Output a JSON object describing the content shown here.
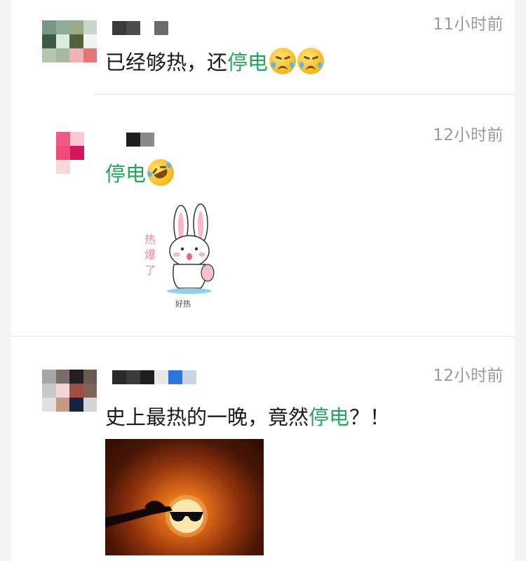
{
  "posts": [
    {
      "time": "11小时前",
      "text_before": "已经够热，还",
      "highlight": "停电",
      "text_after": "",
      "emojis": [
        "persevering-face",
        "persevering-face"
      ]
    },
    {
      "time": "12小时前",
      "text_before": "",
      "highlight": "停电",
      "text_after": "",
      "emojis": [
        "rolling-laughing-face"
      ],
      "sticker": {
        "side_text": [
          "热",
          "爆",
          "了"
        ],
        "caption": "好热"
      }
    },
    {
      "time": "12小时前",
      "text_before": "史上最热的一晚，竟然",
      "highlight": "停电",
      "text_after": "？！",
      "emojis": []
    }
  ],
  "colors": {
    "highlight": "#23a55a",
    "time": "#9a9a9a",
    "divider": "#e6e6e6"
  }
}
